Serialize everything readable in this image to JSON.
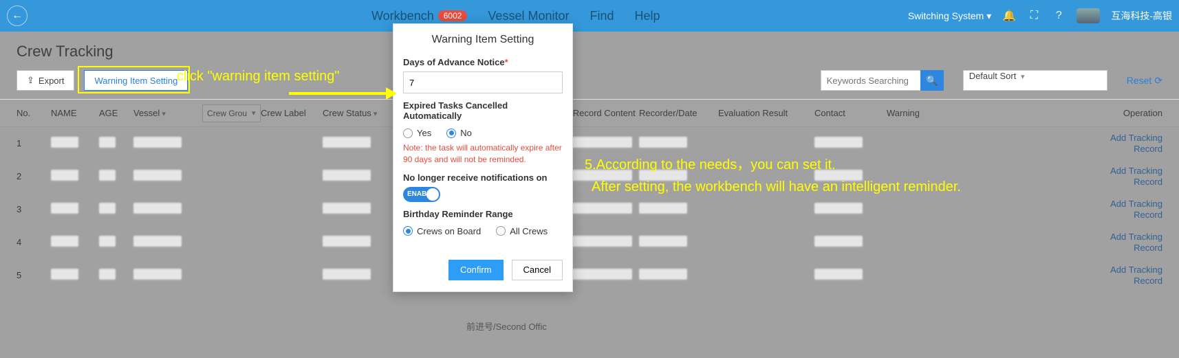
{
  "header": {
    "nav": {
      "workbench": "Workbench",
      "badge": "6002",
      "vessel": "Vessel Monitor",
      "find": "Find",
      "help": "Help"
    },
    "switching": "Switching System",
    "user": "互海科技-高银"
  },
  "page": {
    "title": "Crew Tracking"
  },
  "toolbar": {
    "export": "Export",
    "warning_setting": "Warning Item Setting",
    "search_placeholder": "Keywords Searching",
    "sort": "Default Sort",
    "reset": "Reset"
  },
  "columns": {
    "no": "No.",
    "name": "NAME",
    "age": "AGE",
    "vessel": "Vessel",
    "group": "Crew Grou",
    "label": "Crew Label",
    "status": "Crew Status",
    "rec": "st Record Content",
    "date": "Recorder/Date",
    "eval": "Evaluation Result",
    "contact": "Contact",
    "warning": "Warning",
    "op": "Operation"
  },
  "rows": [
    "1",
    "2",
    "3",
    "4",
    "5"
  ],
  "op_link": "Add Tracking\nRecord",
  "modal": {
    "title": "Warning Item Setting",
    "advance_label": "Days of Advance Notice",
    "advance_value": "7",
    "expired_label": "Expired Tasks Cancelled Automatically",
    "yes": "Yes",
    "no": "No",
    "note": "Note: the task will automatically expire after 90 days and will not be reminded.",
    "notif_label": "No longer receive notifications on",
    "toggle": "ENABL",
    "birthday_label": "Birthday Reminder Range",
    "opt_board": "Crews on Board",
    "opt_all": "All Crews",
    "confirm": "Confirm",
    "cancel": "Cancel"
  },
  "annotations": {
    "a1": "click \"warning item setting\"",
    "a2": "5.According to the needs，you can set it.\n  After setting, the workbench will have an intelligent reminder."
  },
  "below": "前进号/Second Offic"
}
